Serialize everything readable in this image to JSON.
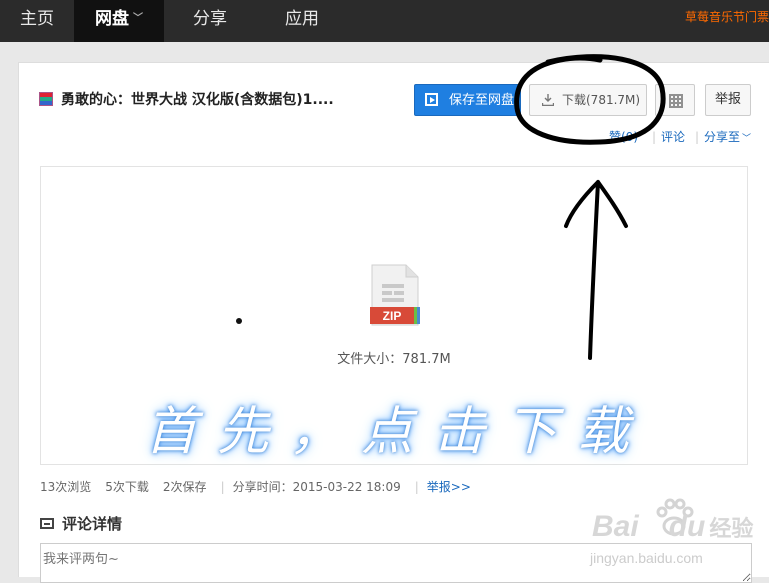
{
  "nav": {
    "home": "主页",
    "disk": "网盘",
    "share": "分享",
    "apps": "应用",
    "promo": "草莓音乐节门票"
  },
  "file": {
    "title": "勇敢的心：世界大战 汉化版(含数据包)1....",
    "size_label": "文件大小：781.7M",
    "type_badge": "ZIP"
  },
  "buttons": {
    "save": "保存至网盘",
    "download": "下载(781.7M)",
    "report": "举报"
  },
  "actions": {
    "like": "赞(0)",
    "comment": "评论",
    "share": "分享至"
  },
  "stats": {
    "views": "13次浏览",
    "downloads": "5次下载",
    "saves": "2次保存",
    "share_time": "分享时间：2015-03-22 18:09",
    "report": "举报>>"
  },
  "comments": {
    "title": "评论详情",
    "placeholder": "我来评两句~"
  },
  "overlay": {
    "caption": "首先，点击下载"
  },
  "watermark": {
    "logo_text": "Bai",
    "logo_du": "du",
    "logo_cn": "经验",
    "url": "jingyan.baidu.com"
  },
  "colors": {
    "nav_bg": "#2b2b2b",
    "save_button": "#1f7fe1",
    "link": "#1a69bd",
    "promo": "#ff6a00"
  }
}
